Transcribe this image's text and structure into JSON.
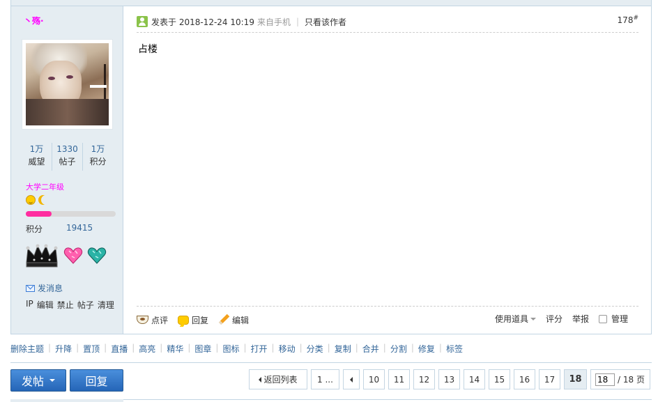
{
  "author": {
    "name": "丶殇·",
    "stats": [
      {
        "num": "1万",
        "label": "威望"
      },
      {
        "num": "1330",
        "label": "帖子"
      },
      {
        "num": "1万",
        "label": "积分"
      }
    ],
    "grade": "大学二年级",
    "progress_fraction": 0.29,
    "score_label": "积分",
    "score_value": "19415",
    "send_message": "发消息",
    "admin_links": [
      "IP",
      "编辑",
      "禁止",
      "帖子",
      "清理"
    ],
    "colors": {
      "name": "#ff00ff",
      "progress": "#ff2da0"
    }
  },
  "post": {
    "posted_label": "发表于 2018-12-24 10:19",
    "from": "来自手机",
    "author_only": "只看该作者",
    "floor": "178",
    "floor_sup": "#",
    "content": "占楼",
    "actions": {
      "comment": "点评",
      "reply": "回复",
      "edit": "编辑",
      "tools": "使用道具",
      "rate": "评分",
      "report": "举报",
      "manage": "管理"
    }
  },
  "moderation": [
    "删除主题",
    "升降",
    "置顶",
    "直播",
    "高亮",
    "精华",
    "图章",
    "图标",
    "打开",
    "移动",
    "分类",
    "复制",
    "合并",
    "分割",
    "修复",
    "标签"
  ],
  "buttons": {
    "new_post": "发帖",
    "reply": "回复"
  },
  "pager": {
    "back": "返回列表",
    "first": "1 ...",
    "pages": [
      "10",
      "11",
      "12",
      "13",
      "14",
      "15",
      "16",
      "17"
    ],
    "current": "18",
    "input_value": "18",
    "total": "/ 18 页"
  },
  "icons": [
    "online-icon",
    "mail-icon",
    "cup-icon",
    "bubble-icon",
    "pencil-icon",
    "crown-medal-icon",
    "pink-heart-medal-icon",
    "teal-heart-medal-icon",
    "sun-icon",
    "moon-icon",
    "caret-down-icon",
    "left-arrow-icon"
  ]
}
